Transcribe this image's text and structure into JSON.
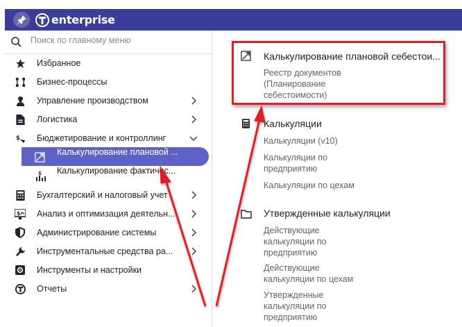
{
  "header": {
    "logo_text": "enterprise",
    "brand_color": "#3b3e98"
  },
  "search": {
    "placeholder": "Поиск по главному меню"
  },
  "menu": {
    "items": [
      {
        "label": "Избранное",
        "icon": "star-icon",
        "has_chevron": false
      },
      {
        "label": "Бизнес-процессы",
        "icon": "workflow-icon",
        "has_chevron": false
      },
      {
        "label": "Управление производством",
        "icon": "worker-icon",
        "has_chevron": true
      },
      {
        "label": "Логистика",
        "icon": "document-icon",
        "has_chevron": true
      },
      {
        "label": "Бюджетирование и контроллинг",
        "icon": "budget-icon",
        "has_chevron": true,
        "expanded": true
      },
      {
        "label": "Бухгалтерский и налоговый учет",
        "icon": "calculator-icon",
        "has_chevron": true
      },
      {
        "label": "Анализ и оптимизация деятельн...",
        "icon": "analytics-icon",
        "has_chevron": true
      },
      {
        "label": "Администрирование системы",
        "icon": "shield-icon",
        "has_chevron": true
      },
      {
        "label": "Инструментальные средства ра...",
        "icon": "wrench-icon",
        "has_chevron": true
      },
      {
        "label": "Инструменты и настройки",
        "icon": "settings-icon",
        "has_chevron": false
      },
      {
        "label": "Отчеты",
        "icon": "reports-icon",
        "has_chevron": true
      }
    ],
    "subitems": [
      {
        "label": "Калькулирование плановой ...",
        "icon": "trend-up-icon",
        "active": true
      },
      {
        "label": "Калькулирование фактичес...",
        "icon": "cost-chart-icon",
        "active": false
      }
    ]
  },
  "content": {
    "sections": [
      {
        "title": "Калькулирование плановой себестои...",
        "icon": "trend-up-icon",
        "links": [
          "Реестр документов\n(Планирование\nсебестоимости)"
        ]
      },
      {
        "title": "Калькуляции",
        "icon": "calculator-icon",
        "links": [
          "Калькуляции (v10)",
          "Калькуляции по\nпредприятию",
          "Калькуляции по цехам"
        ]
      },
      {
        "title": "Утвержденные калькуляции",
        "icon": "folder-icon",
        "links": [
          "Действующие\nкалькуляции по\nпредприятию",
          "Действующие\nкалькуляции по цехам",
          "Утвержденные\nкалькуляции по\nпредприятию"
        ]
      }
    ]
  },
  "colors": {
    "active_item": "#5d62c7",
    "annotation": "#e41e26"
  }
}
